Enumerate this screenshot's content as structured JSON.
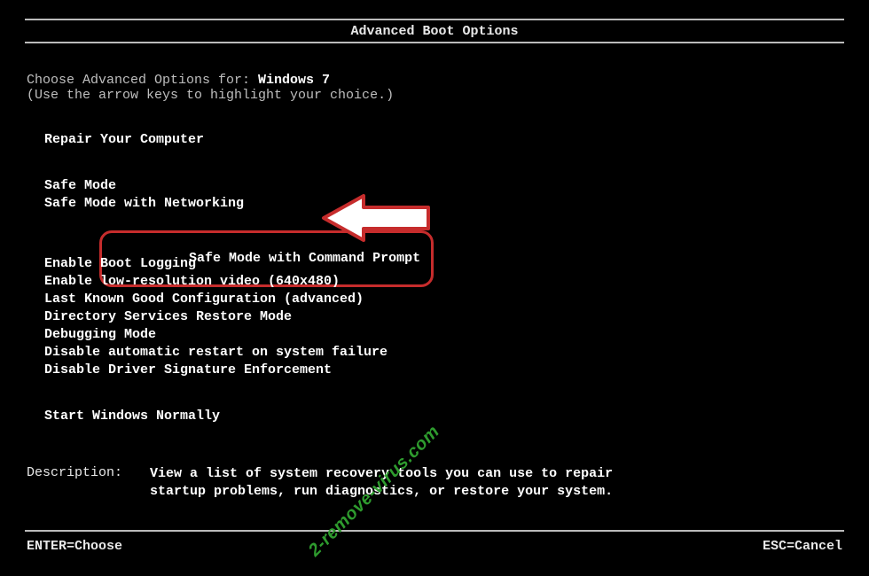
{
  "title": "Advanced Boot Options",
  "choose": {
    "prefix": "Choose Advanced Options for: ",
    "os": "Windows 7",
    "hint": "(Use the arrow keys to highlight your choice.)"
  },
  "menu": {
    "repair": "Repair Your Computer",
    "safe_mode": "Safe Mode",
    "safe_mode_net": "Safe Mode with Networking",
    "safe_mode_cmd": "Safe Mode with Command Prompt",
    "boot_logging": "Enable Boot Logging",
    "low_res": "Enable low-resolution video (640x480)",
    "lkgc": "Last Known Good Configuration (advanced)",
    "ds_restore": "Directory Services Restore Mode",
    "debug": "Debugging Mode",
    "no_auto_restart": "Disable automatic restart on system failure",
    "no_drv_sig": "Disable Driver Signature Enforcement",
    "start_normal": "Start Windows Normally"
  },
  "description": {
    "label": "Description:",
    "text": "View a list of system recovery tools you can use to repair startup problems, run diagnostics, or restore your system."
  },
  "footer": {
    "enter": "ENTER=Choose",
    "esc": "ESC=Cancel"
  },
  "watermark": "2-remove-virus.com",
  "colors": {
    "highlight_border": "#c62c2c",
    "watermark": "#2e9b2e"
  }
}
